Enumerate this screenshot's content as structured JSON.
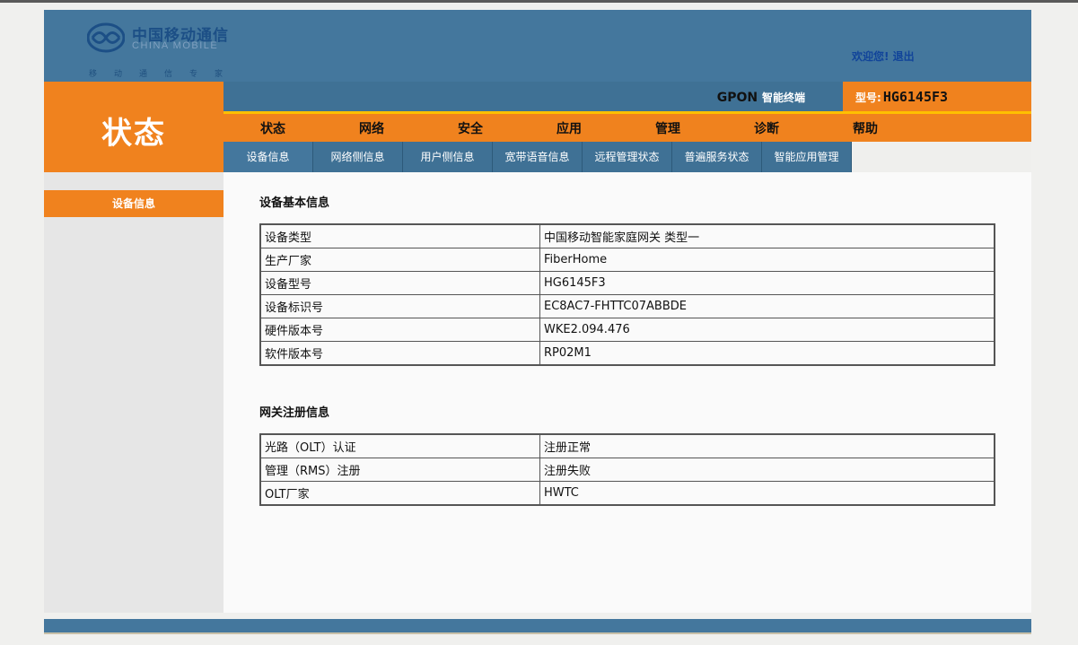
{
  "header": {
    "logo_cn": "中国移动通信",
    "logo_en": "CHINA MOBILE",
    "logo_slogan": "移动通信专家",
    "welcome": "欢迎您!",
    "logout": "退出"
  },
  "status_block": {
    "title": "状态"
  },
  "product": {
    "gpon": "GPON",
    "gpon_sub": "智能终端",
    "model_label": "型号:",
    "model_value": "HG6145F3"
  },
  "main_nav": [
    "状态",
    "网络",
    "安全",
    "应用",
    "管理",
    "诊断",
    "帮助"
  ],
  "sub_nav": [
    "设备信息",
    "网络侧信息",
    "用户侧信息",
    "宽带语音信息",
    "远程管理状态",
    "普遍服务状态",
    "智能应用管理"
  ],
  "sidebar": {
    "item": "设备信息"
  },
  "device_info": {
    "title": "设备基本信息",
    "rows": [
      [
        "设备类型",
        "中国移动智能家庭网关 类型一"
      ],
      [
        "生产厂家",
        "FiberHome"
      ],
      [
        "设备型号",
        "HG6145F3"
      ],
      [
        "设备标识号",
        "EC8AC7-FHTTC07ABBDE"
      ],
      [
        "硬件版本号",
        "WKE2.094.476"
      ],
      [
        "软件版本号",
        "RP02M1"
      ]
    ]
  },
  "registration_info": {
    "title": "网关注册信息",
    "rows": [
      [
        "光路（OLT）认证",
        "注册正常"
      ],
      [
        "管理（RMS）注册",
        "注册失败"
      ],
      [
        "OLT厂家",
        "HWTC"
      ]
    ]
  },
  "colors": {
    "header_blue": "#44779d",
    "accent_orange": "#f0821e",
    "accent_yellow": "#ffc000"
  }
}
